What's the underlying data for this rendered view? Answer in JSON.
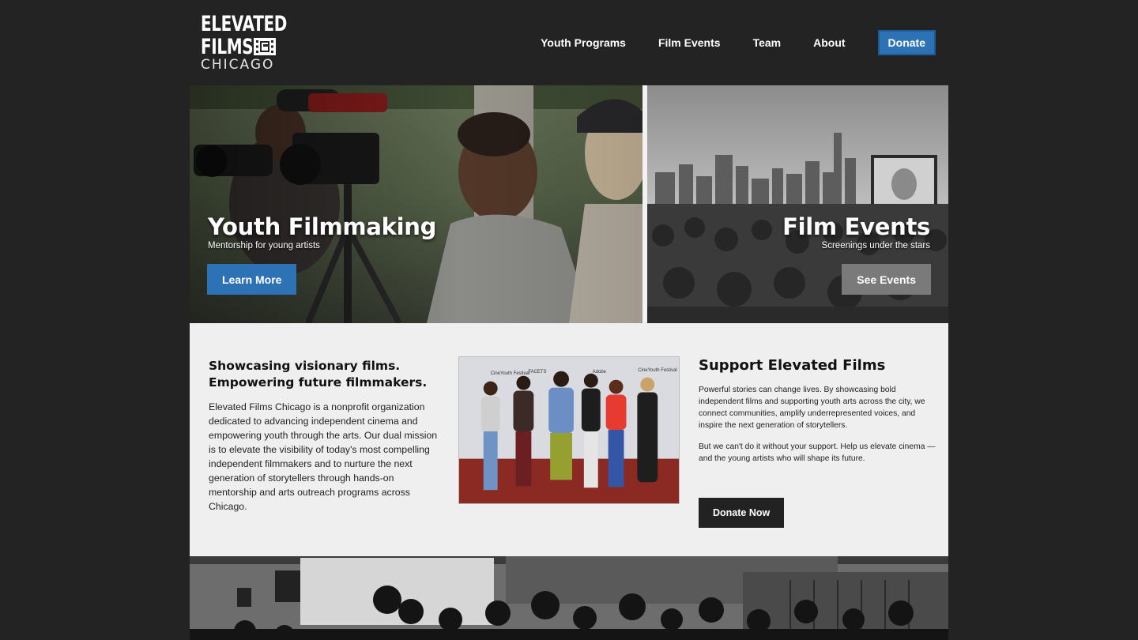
{
  "logo": {
    "line1": "ELEVATED",
    "line2": "FILMS",
    "line3": "CHICAGO"
  },
  "nav": {
    "items": [
      "Youth Programs",
      "Film Events",
      "Team",
      "About"
    ],
    "donate_label": "Donate"
  },
  "hero": {
    "left": {
      "title": "Youth Filmmaking",
      "subtitle": "Mentorship for young artists",
      "button": "Learn More"
    },
    "right": {
      "title": "Film Events",
      "subtitle": "Screenings under the stars",
      "button": "See Events"
    }
  },
  "mission": {
    "heading_line1": "Showcasing visionary films.",
    "heading_line2": "Empowering future filmmakers.",
    "body": "Elevated Films Chicago is a nonprofit organization dedicated to advancing independent cinema and empowering youth through the arts. Our dual mission is to elevate the visibility of today's most compelling independent filmmakers and to nurture the next generation of storytellers through hands-on mentorship and arts outreach programs across Chicago."
  },
  "support": {
    "heading": "Support Elevated Films",
    "para1": "Powerful stories can change lives. By showcasing bold independent films and supporting youth arts across the city, we connect communities, amplify underrepresented voices, and inspire the next generation of storytellers.",
    "para2": "But we can't do it without your support. Help us elevate cinema — and the young artists who will shape its future.",
    "button": "Donate Now"
  },
  "photo_backdrop": {
    "label1": "FACETS",
    "label2": "CineYouth Festival",
    "label3": "Adobe"
  },
  "colors": {
    "page_bg": "#232323",
    "accent_blue": "#2e72b6",
    "info_bg": "#efefef",
    "gray_button": "#7a7a7a",
    "dark_button": "#222222"
  }
}
